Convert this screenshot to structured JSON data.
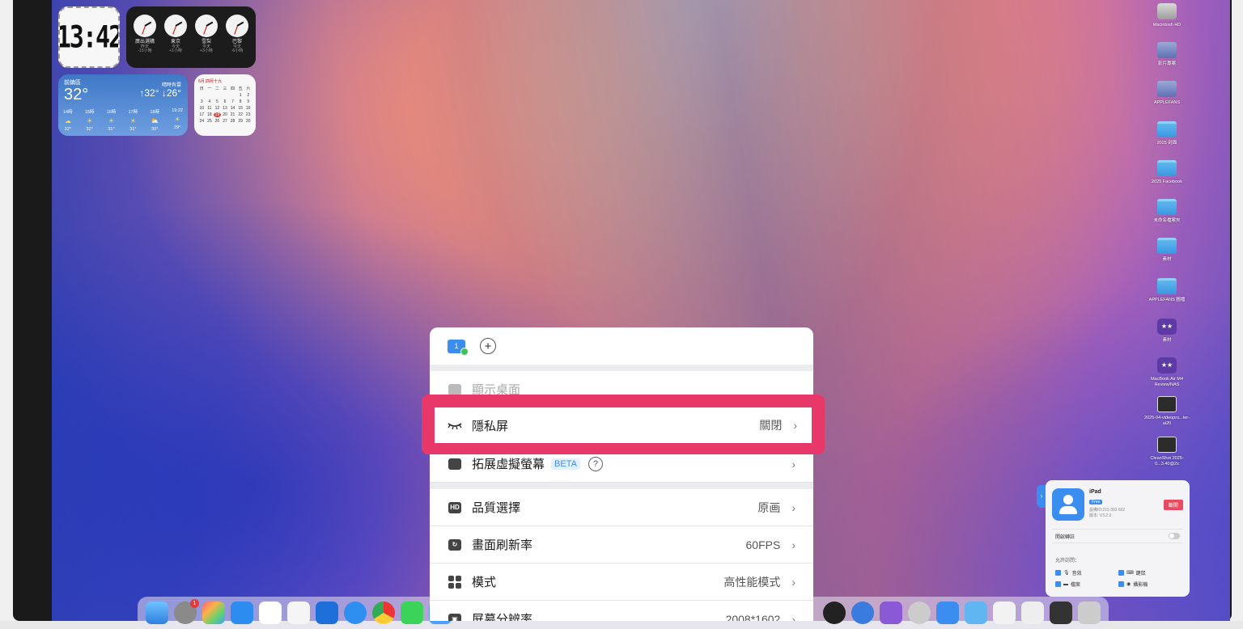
{
  "desktop": {
    "widgets": {
      "digital_clock": {
        "time": "13:42"
      },
      "world_clock": [
        {
          "city": "廣出選購",
          "day": "昨天",
          "offset": "-15小時"
        },
        {
          "city": "東京",
          "day": "今天",
          "offset": "+1小時"
        },
        {
          "city": "雪梨",
          "day": "今天",
          "offset": "+3小時"
        },
        {
          "city": "巴黎",
          "day": "今天",
          "offset": "-6小時"
        }
      ],
      "weather": {
        "location": "前鎮區",
        "temp": "32°",
        "condition": "晴時有雲",
        "hi_lo": "↑32° ↓26°",
        "hours": [
          {
            "time": "14時",
            "temp": "32°"
          },
          {
            "time": "15時",
            "temp": "32°"
          },
          {
            "time": "16時",
            "temp": "31°"
          },
          {
            "time": "17時",
            "temp": "31°"
          },
          {
            "time": "18時",
            "temp": "30°"
          },
          {
            "time": "19:22",
            "temp": "29°"
          }
        ]
      },
      "calendar": {
        "month": "6月 四月十九",
        "weekdays": [
          "日",
          "一",
          "二",
          "三",
          "四",
          "五",
          "六"
        ],
        "today": "19"
      }
    },
    "icons": [
      {
        "label": "Macintosh HD",
        "kind": "hd"
      },
      {
        "label": "影片專案",
        "kind": "vol"
      },
      {
        "label": "APPLEFANS",
        "kind": "vol"
      },
      {
        "label": "2025 封面",
        "kind": "folder"
      },
      {
        "label": "2025 Facebook",
        "kind": "folder"
      },
      {
        "label": "未命名檔案夾",
        "kind": "folder"
      },
      {
        "label": "素材",
        "kind": "folder"
      },
      {
        "label": "APPLEFANS 圖檔",
        "kind": "folder"
      },
      {
        "label": "素材",
        "kind": "star"
      },
      {
        "label": "MacBook Air M4 Review/NAS",
        "kind": "star"
      },
      {
        "label": "2025-04-videopro...ter-ai20",
        "kind": "shot"
      },
      {
        "label": "CleanShot 2025-0...3.40@2x",
        "kind": "shot"
      }
    ]
  },
  "menu": {
    "screen_number": "1",
    "add_symbol": "+",
    "show_desktop": "顯示桌面",
    "privacy_screen": {
      "label": "隱私屏",
      "value": "關閉"
    },
    "extend_display": {
      "label": "拓展虛擬螢幕",
      "beta": "BETA",
      "help": "?"
    },
    "quality": {
      "icon": "HD",
      "label": "品質選擇",
      "value": "原画"
    },
    "refresh": {
      "label": "畫面刷新率",
      "value": "60FPS"
    },
    "mode": {
      "label": "模式",
      "value": "高性能模式"
    },
    "resolution": {
      "label": "屏幕分辨率",
      "value": "2008*1602"
    },
    "chevron": "›"
  },
  "device_panel": {
    "tab_arrow": "›",
    "name": "iPad",
    "free_badge": "Free",
    "device_id": "設備ID:215 393 602",
    "version": "版本: V3.2.0",
    "disconnect": "斷開",
    "option_label": "開啟轉註",
    "permissions_title": "允許訪問：",
    "permissions": [
      "音效",
      "鍵鼠",
      "檔案",
      "攝影機"
    ]
  },
  "dock": {
    "settings_badge": "1"
  },
  "colors": {
    "highlight": "#e8386a",
    "accent": "#3b8ef0"
  }
}
